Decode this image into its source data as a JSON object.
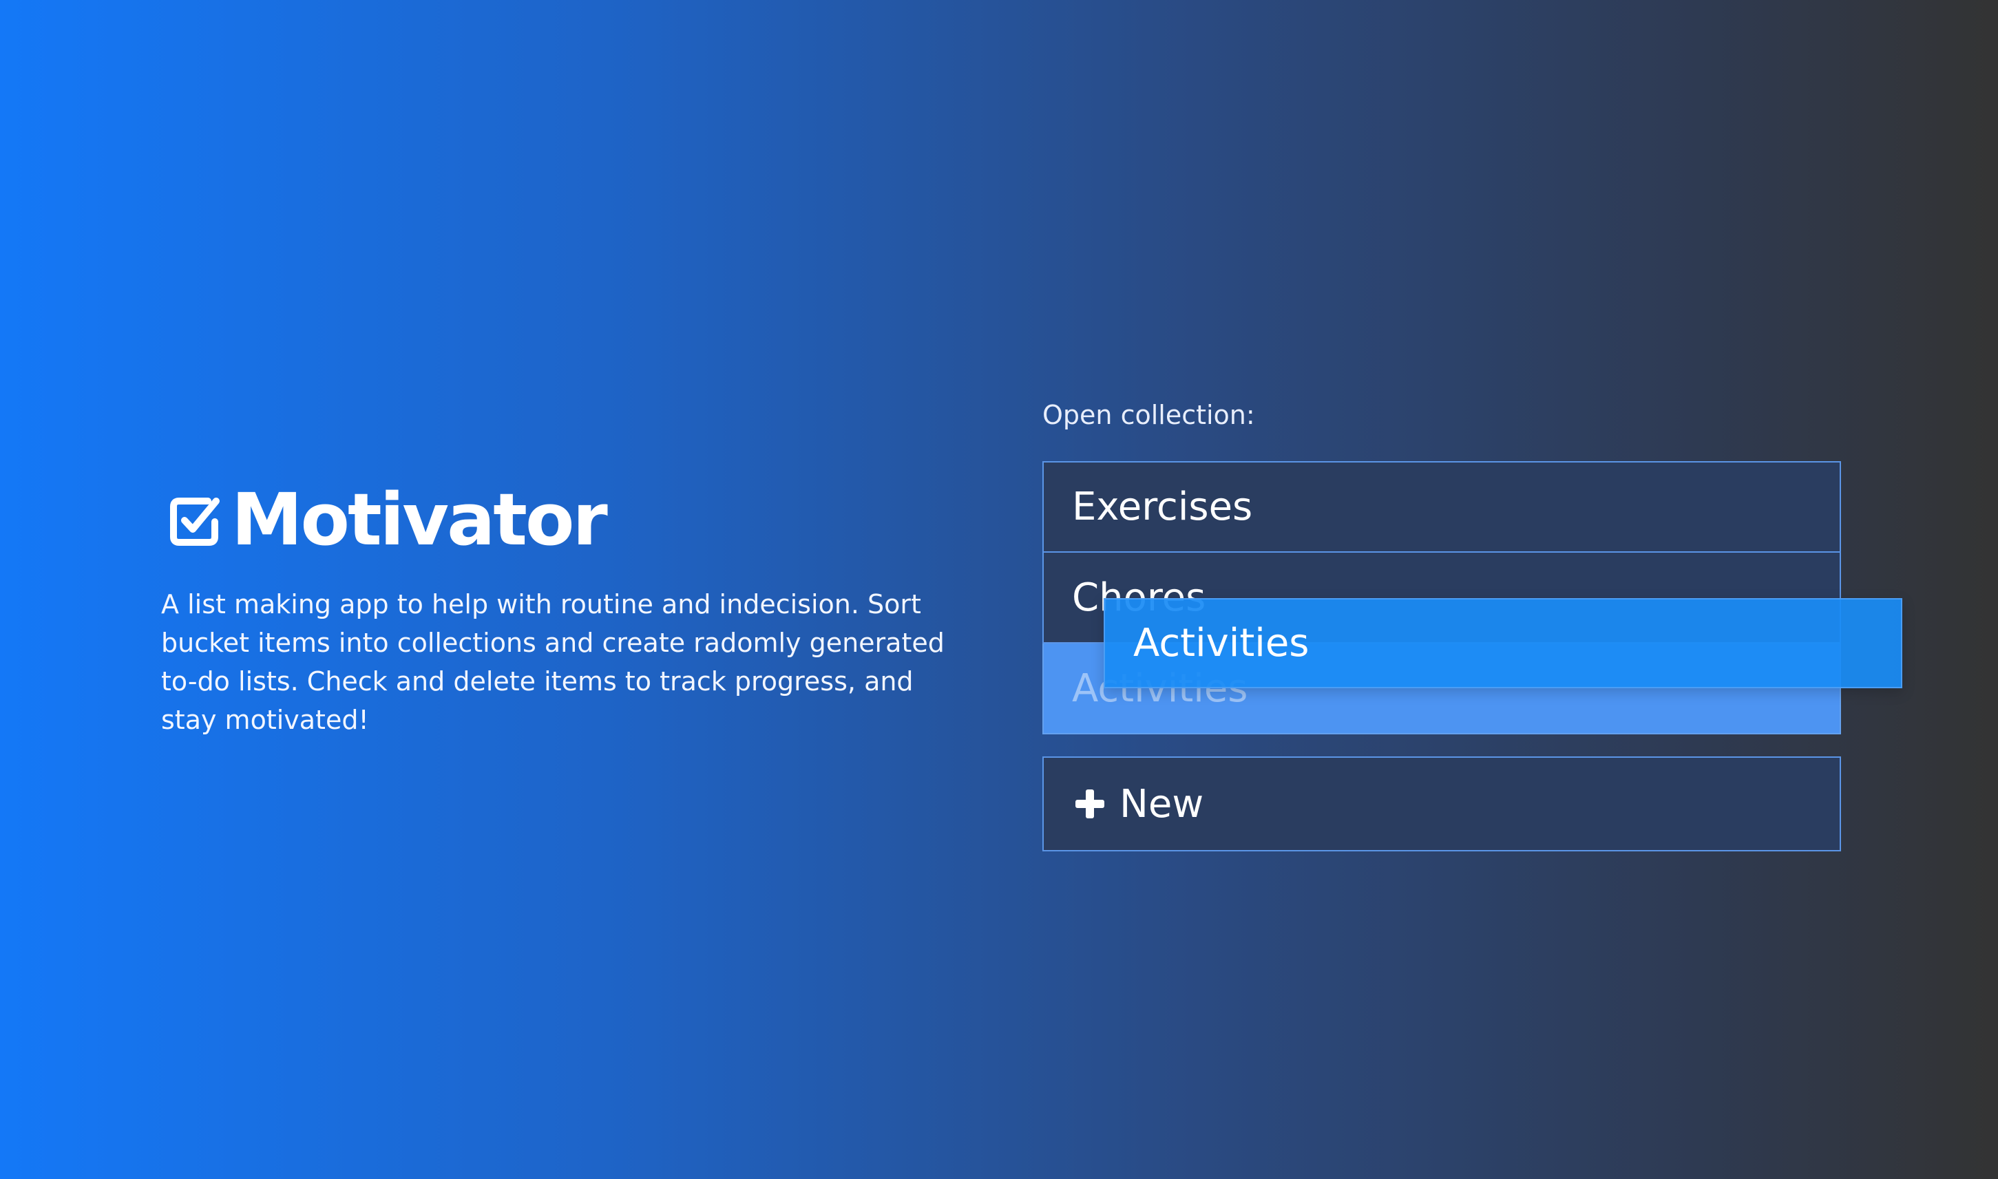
{
  "brand": {
    "name": "Motivator",
    "tagline": "A list making app to help with routine and indecision. Sort bucket items into collections and create radomly generated to-do lists. Check and delete items to track progress, and stay motivated!"
  },
  "collections": {
    "label": "Open collection:",
    "items": [
      {
        "label": "Exercises"
      },
      {
        "label": "Chores"
      },
      {
        "label": "Activities"
      }
    ],
    "dragging_label": "Activities",
    "new_button_label": "New"
  },
  "icons": {
    "logo": "checkbox-icon",
    "new": "plus-icon"
  },
  "colors": {
    "gradient_start": "#1478f7",
    "gradient_end": "#333333",
    "item_border": "#5b95e6",
    "item_bg": "#2a3d60",
    "placeholder_bg": "#4d94f2",
    "drag_bg": "#1a8cf5"
  }
}
